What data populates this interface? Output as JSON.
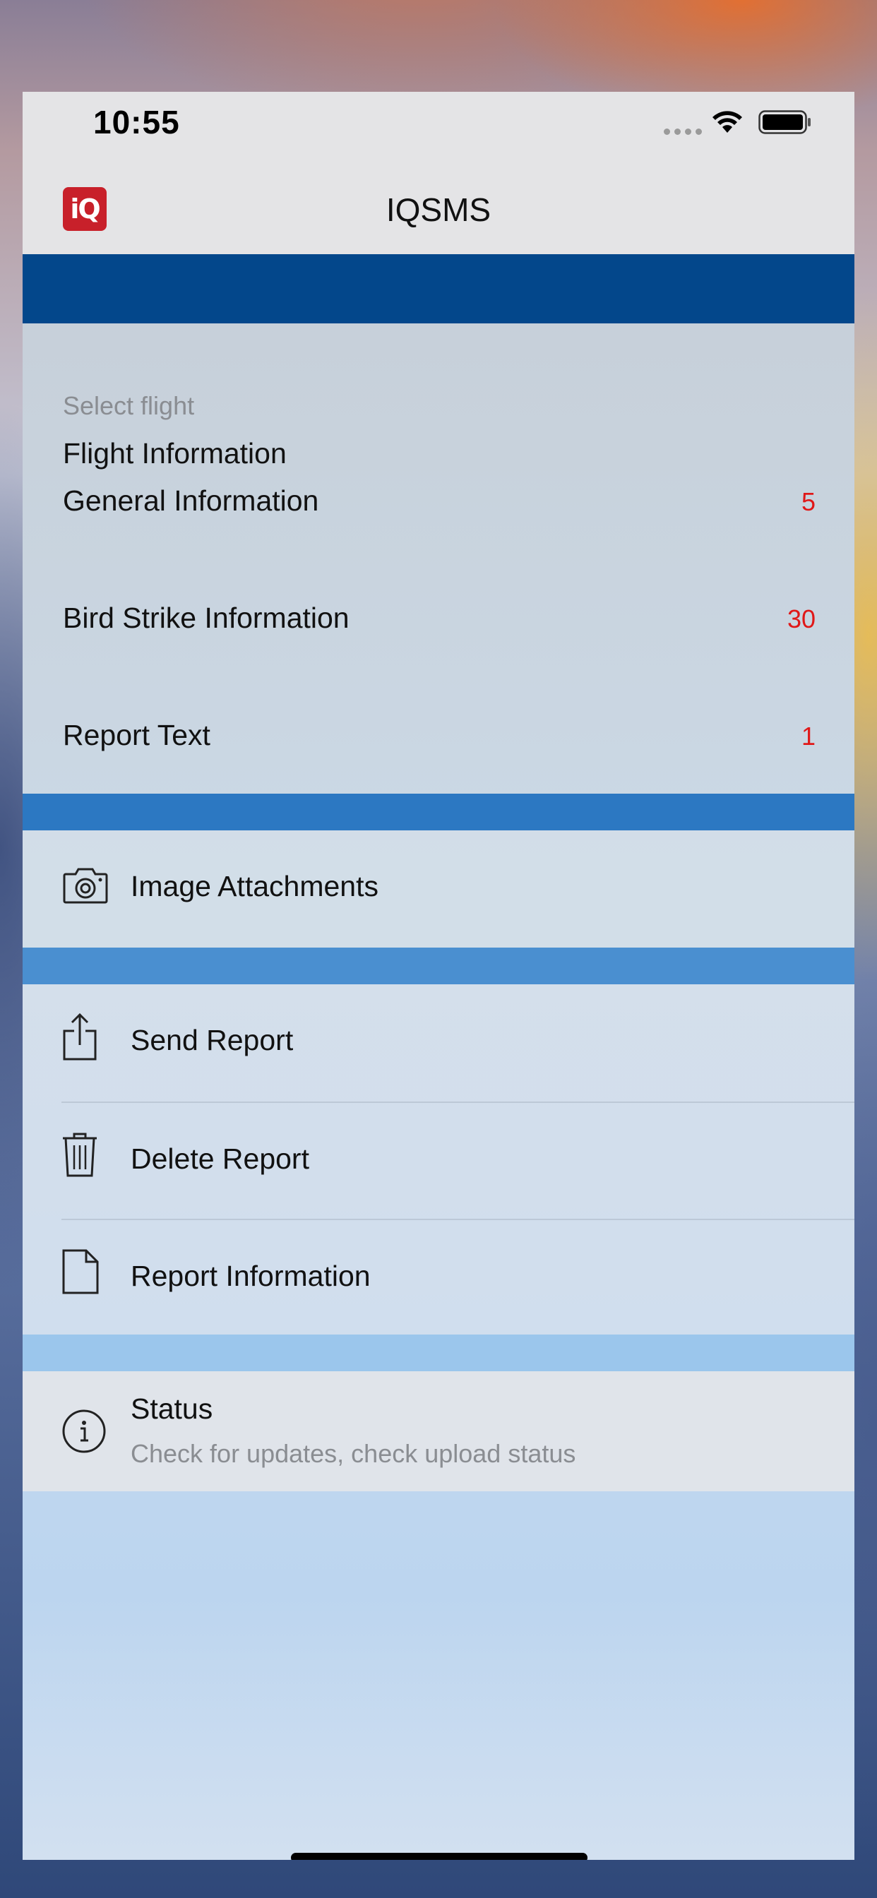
{
  "status_bar": {
    "time": "10:55"
  },
  "nav": {
    "logo_text": "iQ",
    "title": "IQSMS"
  },
  "sections": {
    "report_items": [
      {
        "label": "Flight Information",
        "subtitle": "Select flight",
        "count": ""
      },
      {
        "label": "General Information",
        "subtitle": "",
        "count": "5"
      },
      {
        "label": "Bird Strike Information",
        "subtitle": "",
        "count": "30"
      },
      {
        "label": "Report Text",
        "subtitle": "",
        "count": "1"
      }
    ],
    "attachments": {
      "label": "Image Attachments",
      "icon": "camera-icon"
    },
    "actions": [
      {
        "label": "Send Report",
        "icon": "share-icon"
      },
      {
        "label": "Delete Report",
        "icon": "trash-icon"
      },
      {
        "label": "Report Information",
        "icon": "document-icon"
      }
    ],
    "status": {
      "label": "Status",
      "subtitle": "Check for updates, check upload status",
      "icon": "info-icon"
    }
  },
  "colors": {
    "header_band": "#03478b",
    "accent_red": "#e01818",
    "logo_red": "#c8202a"
  }
}
